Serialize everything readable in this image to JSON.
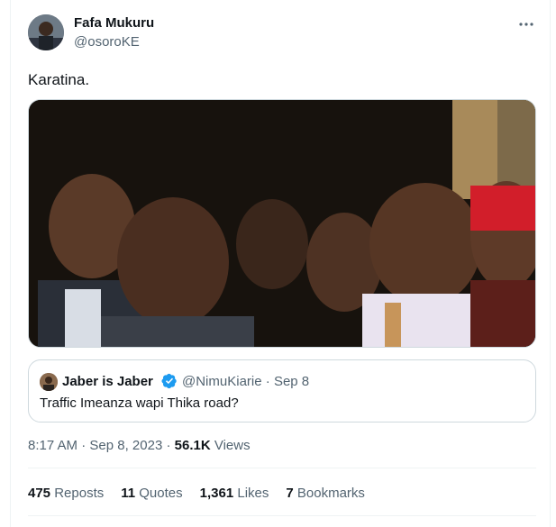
{
  "author": {
    "display_name": "Fafa Mukuru",
    "handle": "@osoroKE"
  },
  "more_icon": "more-horizontal-icon",
  "tweet": {
    "text": "Karatina."
  },
  "quoted_tweet": {
    "display_name": "Jaber is Jaber",
    "verified_icon": "verified-badge-icon",
    "verified_color": "#1d9bf0",
    "handle": "@NimuKiarie",
    "separator": "·",
    "date": "Sep 8",
    "text": "Traffic Imeanza wapi Thika road?"
  },
  "meta": {
    "time": "8:17 AM",
    "sep1": "·",
    "date": "Sep 8, 2023",
    "sep2": "·",
    "views_count": "56.1K",
    "views_label": "Views"
  },
  "stats": {
    "reposts": {
      "count": "475",
      "label": "Reposts"
    },
    "quotes": {
      "count": "11",
      "label": "Quotes"
    },
    "likes": {
      "count": "1,361",
      "label": "Likes"
    },
    "bookmarks": {
      "count": "7",
      "label": "Bookmarks"
    }
  }
}
